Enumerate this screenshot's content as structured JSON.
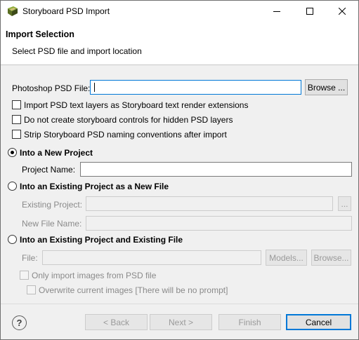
{
  "window": {
    "title": "Storyboard PSD Import"
  },
  "banner": {
    "title": "Import Selection",
    "subtitle": "Select PSD file and import location"
  },
  "psd_file": {
    "label": "Photoshop PSD File:",
    "value": "",
    "browse_label": "Browse ..."
  },
  "options": [
    {
      "label": "Import PSD text layers as Storyboard text render extensions",
      "checked": false
    },
    {
      "label": "Do not create storyboard controls for hidden PSD layers",
      "checked": false
    },
    {
      "label": "Strip Storyboard PSD naming conventions after import",
      "checked": false
    }
  ],
  "new_project": {
    "radio_label": "Into a New Project",
    "selected": true,
    "name_label": "Project Name:",
    "name_value": ""
  },
  "existing_new_file": {
    "radio_label": "Into an Existing Project as a New File",
    "selected": false,
    "project_label": "Existing Project:",
    "project_value": "",
    "project_browse": "...",
    "file_label": "New File Name:",
    "file_value": ""
  },
  "existing_file": {
    "radio_label": "Into an Existing Project and Existing File",
    "selected": false,
    "file_label": "File:",
    "file_value": "",
    "models_label": "Models...",
    "browse_label": "Browse...",
    "only_images_label": "Only import images from PSD file",
    "overwrite_label": "Overwrite current images [There will be no prompt]"
  },
  "footer": {
    "help_glyph": "?",
    "back_label": "< Back",
    "next_label": "Next >",
    "finish_label": "Finish",
    "cancel_label": "Cancel"
  },
  "colors": {
    "focus_border": "#0078d7",
    "window_bg": "#f0f0f0",
    "banner_bg": "#ffffff"
  }
}
